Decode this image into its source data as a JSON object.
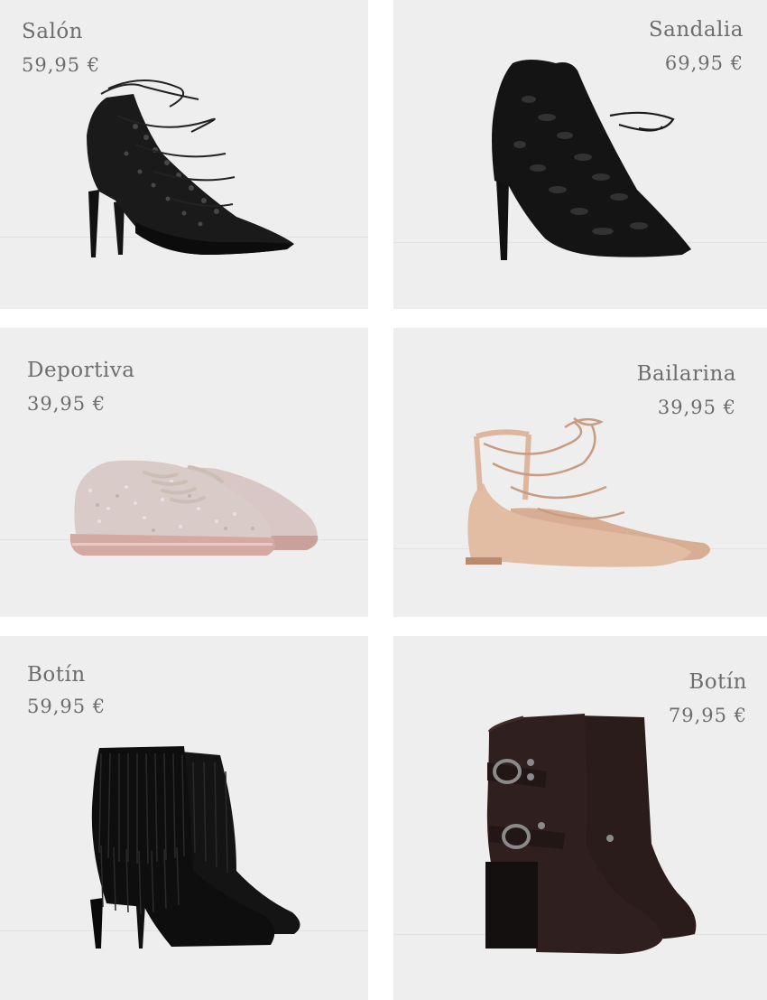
{
  "products": [
    {
      "name": "Salón",
      "price": "59,95 €",
      "image": "black-lace-up-pump-shoe"
    },
    {
      "name": "Sandalia",
      "price": "69,95 €",
      "image": "black-cutout-lace-up-sandal"
    },
    {
      "name": "Deportiva",
      "price": "39,95 €",
      "image": "pink-glitter-sneaker"
    },
    {
      "name": "Bailarina",
      "price": "39,95 €",
      "image": "nude-lace-up-ballerina-flat"
    },
    {
      "name": "Botín",
      "price": "59,95 €",
      "image": "black-fringe-ankle-boot"
    },
    {
      "name": "Botín",
      "price": "79,95 €",
      "image": "brown-leather-buckle-boot"
    }
  ]
}
